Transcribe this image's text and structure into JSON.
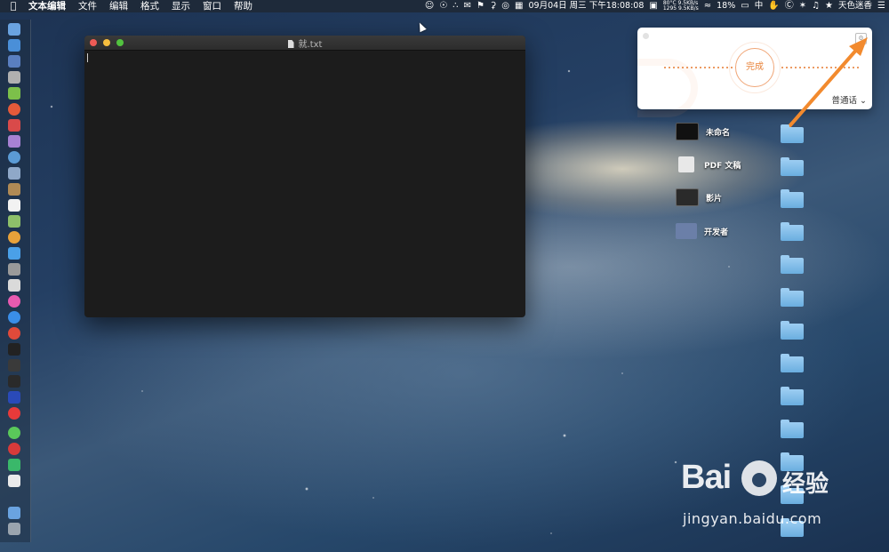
{
  "menubar": {
    "app_name": "文本编辑",
    "items": [
      "文件",
      "编辑",
      "格式",
      "显示",
      "窗口",
      "帮助"
    ],
    "status": {
      "net_up": "80°C  9.5KB/s",
      "net_down": "1295  9.5KB/s",
      "clock": "09月04日 周三 下午18:08:08",
      "battery": "18%",
      "input_method": "中",
      "user": "天色迷香"
    }
  },
  "window": {
    "title": "就.txt"
  },
  "dictation": {
    "done_label": "完成",
    "language_label": "普通话 ⌄"
  },
  "desktop": {
    "items": [
      {
        "label": "未命名",
        "color": "#111111"
      },
      {
        "label": "PDF 文稿",
        "color": "#e8e8e8"
      },
      {
        "label": "影片",
        "color": "#2a2a2a"
      },
      {
        "label": "开发者",
        "color": "#6b7fa8"
      }
    ]
  },
  "watermark": {
    "logo_prefix": "Bai",
    "logo_suffix": "经验",
    "url": "jingyan.baidu.com"
  },
  "colors": {
    "accent": "#e8833a",
    "arrow": "#f28a2e"
  }
}
